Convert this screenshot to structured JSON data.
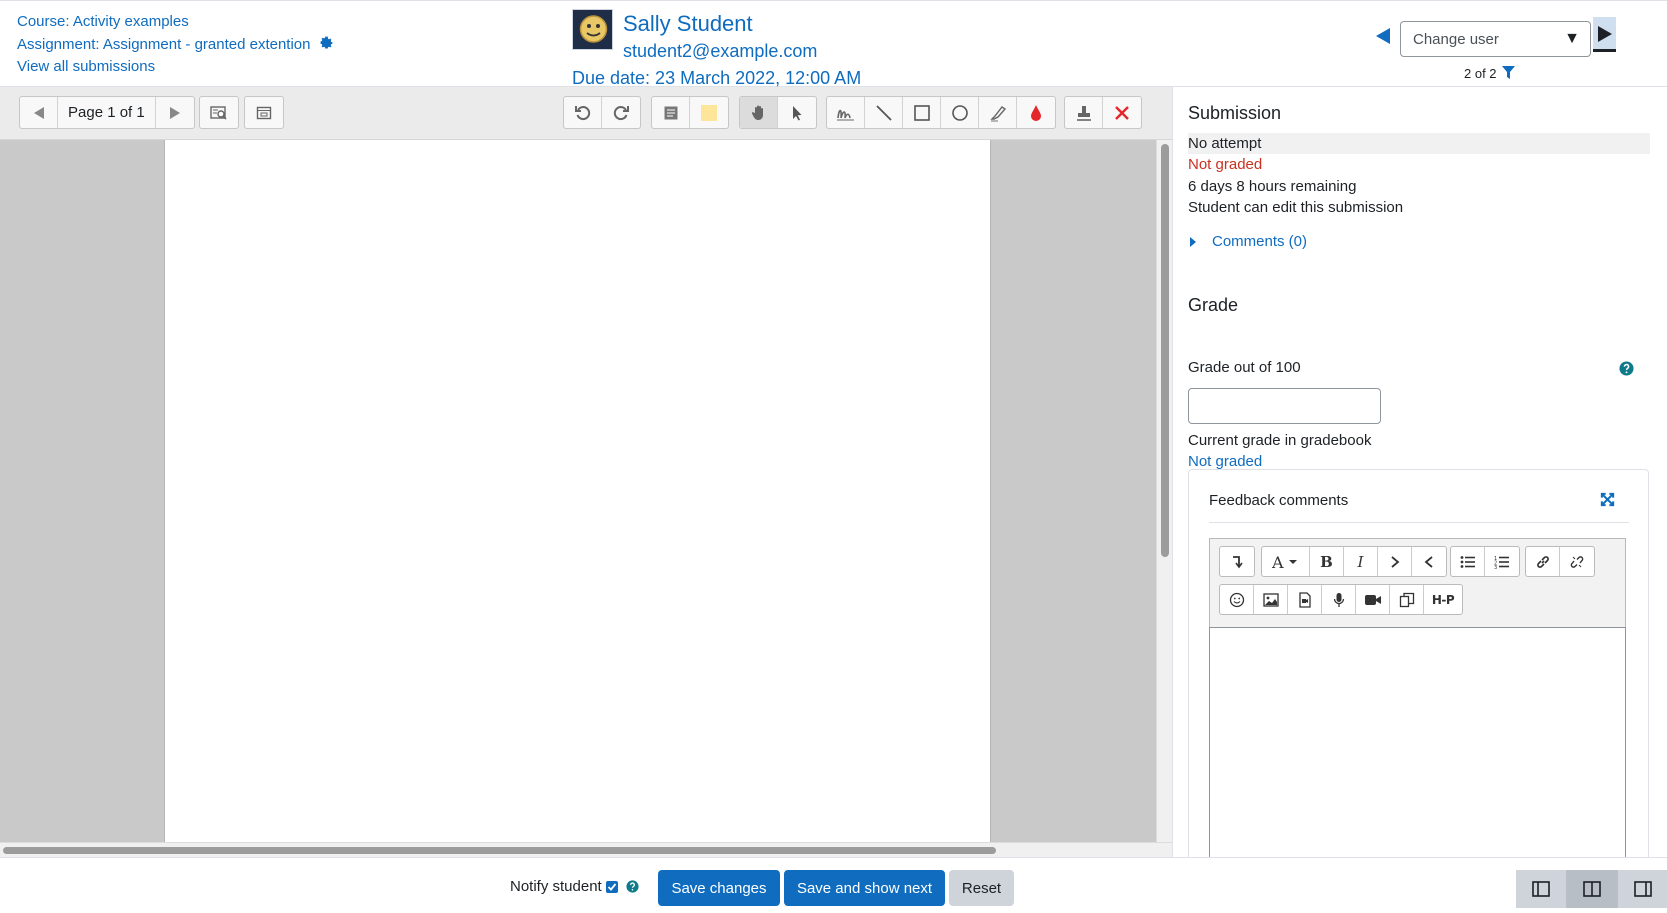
{
  "header": {
    "course_link": "Course: Activity examples",
    "assignment_link": "Assignment: Assignment - granted extention",
    "view_all_link": "View all submissions",
    "user_name": "Sally Student",
    "user_email": "student2@example.com",
    "due_date": "Due date: 23 March 2022, 12:00 AM",
    "change_user_placeholder": "Change user",
    "pager_count": "2 of 2"
  },
  "editor": {
    "page_label": "Page 1 of 1",
    "toolbar_icons": [
      "previous-page-icon",
      "next-page-icon",
      "search-comments-icon",
      "expand-comments-icon",
      "rotate-left-icon",
      "rotate-right-icon",
      "comment-icon",
      "comment-colour-icon",
      "pan-icon",
      "select-icon",
      "pen-icon",
      "line-icon",
      "rectangle-icon",
      "oval-icon",
      "highlight-icon",
      "annotation-colour-icon",
      "stamp-icon",
      "stamp-cross-icon"
    ],
    "colors": {
      "comment_swatch": "#fde59a",
      "annotation_red": "#e5262a",
      "cross_red": "#e5262a"
    }
  },
  "panel": {
    "submission_title": "Submission",
    "status_attempt": "No attempt",
    "status_grading": "Not graded",
    "time_remaining": "6 days 8 hours remaining",
    "edit_status": "Student can edit this submission",
    "comments_link": "Comments (0)",
    "grade_title": "Grade",
    "grade_label": "Grade out of 100",
    "grade_value": "",
    "gradebook_label": "Current grade in gradebook",
    "gradebook_value": "Not graded",
    "feedback_title": "Feedback comments",
    "editor_icons": [
      "collapse-icon",
      "font-style-icon",
      "bold-icon",
      "italic-icon",
      "indent-icon",
      "outdent-icon",
      "unordered-list-icon",
      "ordered-list-icon",
      "link-icon",
      "unlink-icon",
      "emoji-icon",
      "image-icon",
      "media-icon",
      "record-audio-icon",
      "record-video-icon",
      "manage-files-icon",
      "h5p-icon"
    ],
    "h5p_label": "H-P"
  },
  "footer": {
    "notify_label": "Notify student",
    "save_button": "Save changes",
    "save_next_button": "Save and show next",
    "reset_button": "Reset"
  },
  "colors": {
    "accent": "#0f6cbf",
    "not_graded_red": "#ca3120"
  }
}
